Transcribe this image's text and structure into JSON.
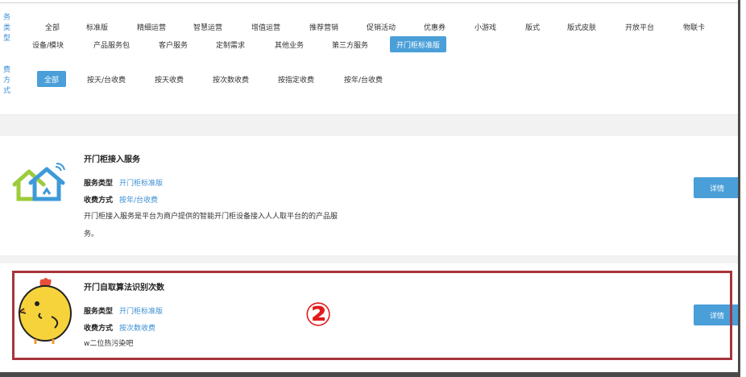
{
  "filters": {
    "type_label": "务类型",
    "type_chips_row1": [
      "全部",
      "标准版",
      "精细运营",
      "智慧运营",
      "增值运营",
      "推荐营销",
      "促销活动",
      "优惠券",
      "小游戏",
      "版式",
      "版式皮肤",
      "开放平台",
      "物联卡"
    ],
    "type_chips_row2": [
      "设备/模块",
      "产品服务包",
      "客户服务",
      "定制需求",
      "其他业务",
      "第三方服务",
      "开门柜标准版"
    ],
    "type_active": "开门柜标准版",
    "fee_label": "费方式",
    "fee_chips": [
      "全部",
      "按天/台收费",
      "按天收费",
      "按次数收费",
      "按指定收费",
      "按年/台收费"
    ],
    "fee_active": "全部"
  },
  "cards": [
    {
      "title": "开门柜接入服务",
      "service_type_key": "服务类型",
      "service_type_val": "开门柜标准版",
      "fee_key": "收费方式",
      "fee_val": "按年/台收费",
      "desc": "开门柜接入服务是平台为商户提供的智能开门柜设备接入人人取平台的的产品服务。",
      "button": "详情",
      "icon": "smart-home-icon"
    },
    {
      "title": "开门自取算法识别次数",
      "service_type_key": "服务类型",
      "service_type_val": "开门柜标准版",
      "fee_key": "收费方式",
      "fee_val": "按次数收费",
      "desc": "w二位热污染吧",
      "button": "详情",
      "icon": "chick-icon"
    }
  ],
  "annotation": "②",
  "colors": {
    "accent": "#4a9fd8",
    "highlight": "#a8343c",
    "annotation": "#e21b1b"
  }
}
